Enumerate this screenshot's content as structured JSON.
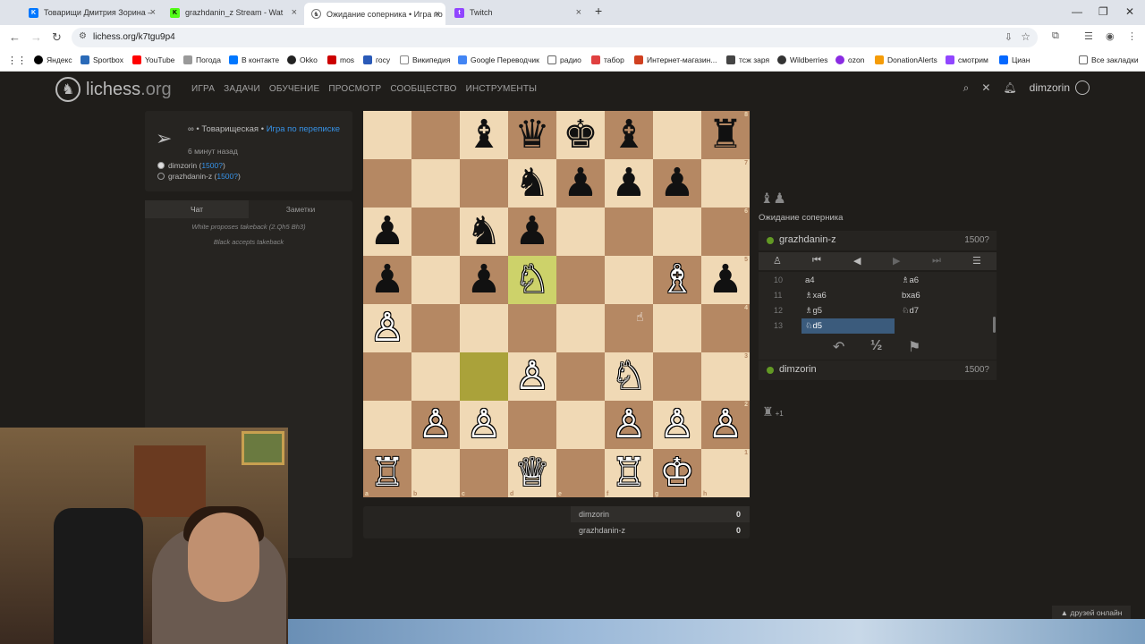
{
  "browser": {
    "tabs": [
      {
        "label": "Товарищи Дмитрия Зорина –",
        "icon": "vk-icon",
        "color": "#0077ff"
      },
      {
        "label": "grazhdanin_z Stream - Wat",
        "icon": "kick-icon",
        "color": "#53fc18"
      },
      {
        "label": "Ожидание соперника • Игра по",
        "icon": "lichess-icon",
        "color": "#555555"
      },
      {
        "label": "Twitch",
        "icon": "twitch-icon",
        "color": "#9146ff"
      }
    ],
    "url": "lichess.org/k7tgu9p4",
    "bookmarks": [
      "Яндекс",
      "Sportbox",
      "YouTube",
      "Погода",
      "В контакте",
      "Okko",
      "mos",
      "госу",
      "Википедия",
      "Google Переводчик",
      "радио",
      "табор",
      "Интернет-магазин...",
      "тсж заря",
      "Wildberries",
      "ozon",
      "DonationAlerts",
      "смотрим",
      "Циан"
    ],
    "all_bookmarks": "Все закладки"
  },
  "site": {
    "logo": "lichess",
    "logo_suffix": ".org",
    "nav": [
      "ИГРА",
      "ЗАДАЧИ",
      "ОБУЧЕНИЕ",
      "ПРОСМОТР",
      "СООБЩЕСТВО",
      "ИНСТРУМЕНТЫ"
    ],
    "username": "dimzorin"
  },
  "game_info": {
    "type_prefix": "∞ • Товарищеская • ",
    "type_link": "Игра по переписке",
    "time_ago": "6 минут назад",
    "white": {
      "name": "dimzorin",
      "rating": "1500?"
    },
    "black": {
      "name": "grazhdanin-z",
      "rating": "1500?"
    }
  },
  "chat": {
    "tab_chat": "Чат",
    "tab_notes": "Заметки",
    "messages": [
      "White proposes takeback (2.Qh5 Bh3)",
      "Black accepts takeback"
    ]
  },
  "board": {
    "ranks": [
      [
        "",
        "",
        "♝",
        "♛",
        "♚",
        "♝",
        "",
        "♜"
      ],
      [
        "",
        "",
        "",
        "♞",
        "♟",
        "♟",
        "♟",
        ""
      ],
      [
        "♟",
        "",
        "♞",
        "♟",
        "",
        "",
        "",
        ""
      ],
      [
        "♟",
        "",
        "♟",
        "♘",
        "",
        "",
        "♗",
        "♟"
      ],
      [
        "♙",
        "",
        "",
        "",
        "",
        "",
        "",
        ""
      ],
      [
        "",
        "",
        "",
        "♙",
        "",
        "♘",
        "",
        ""
      ],
      [
        "",
        "♙",
        "♙",
        "",
        "",
        "♙",
        "♙",
        "♙"
      ],
      [
        "♖",
        "",
        "",
        "♕",
        "",
        "♖",
        "♔",
        ""
      ]
    ],
    "files": [
      "a",
      "b",
      "c",
      "d",
      "e",
      "f",
      "g",
      "h"
    ],
    "rank_labels": [
      "8",
      "7",
      "6",
      "5",
      "4",
      "3",
      "2",
      "1"
    ],
    "last_move": {
      "from": "c3",
      "to": "d5"
    }
  },
  "scores": [
    {
      "name": "dimzorin",
      "score": "0"
    },
    {
      "name": "grazhdanin-z",
      "score": "0"
    }
  ],
  "right": {
    "waiting": "Ожидание соперника",
    "top_player": {
      "name": "grazhdanin-z",
      "rating": "1500?"
    },
    "bottom_player": {
      "name": "dimzorin",
      "rating": "1500?"
    },
    "captured_top": "♝♟",
    "captured_bottom": "♜",
    "captured_bottom_diff": "+1",
    "moves": [
      {
        "num": "10",
        "white": "a4",
        "black": "♗a6"
      },
      {
        "num": "11",
        "white": "♗xa6",
        "black": "bxa6"
      },
      {
        "num": "12",
        "white": "♗g5",
        "black": "♘d7"
      },
      {
        "num": "13",
        "white": "♘d5",
        "black": ""
      }
    ],
    "draw_label": "½"
  },
  "footer": {
    "friends": "▲ друзей онлайн"
  }
}
